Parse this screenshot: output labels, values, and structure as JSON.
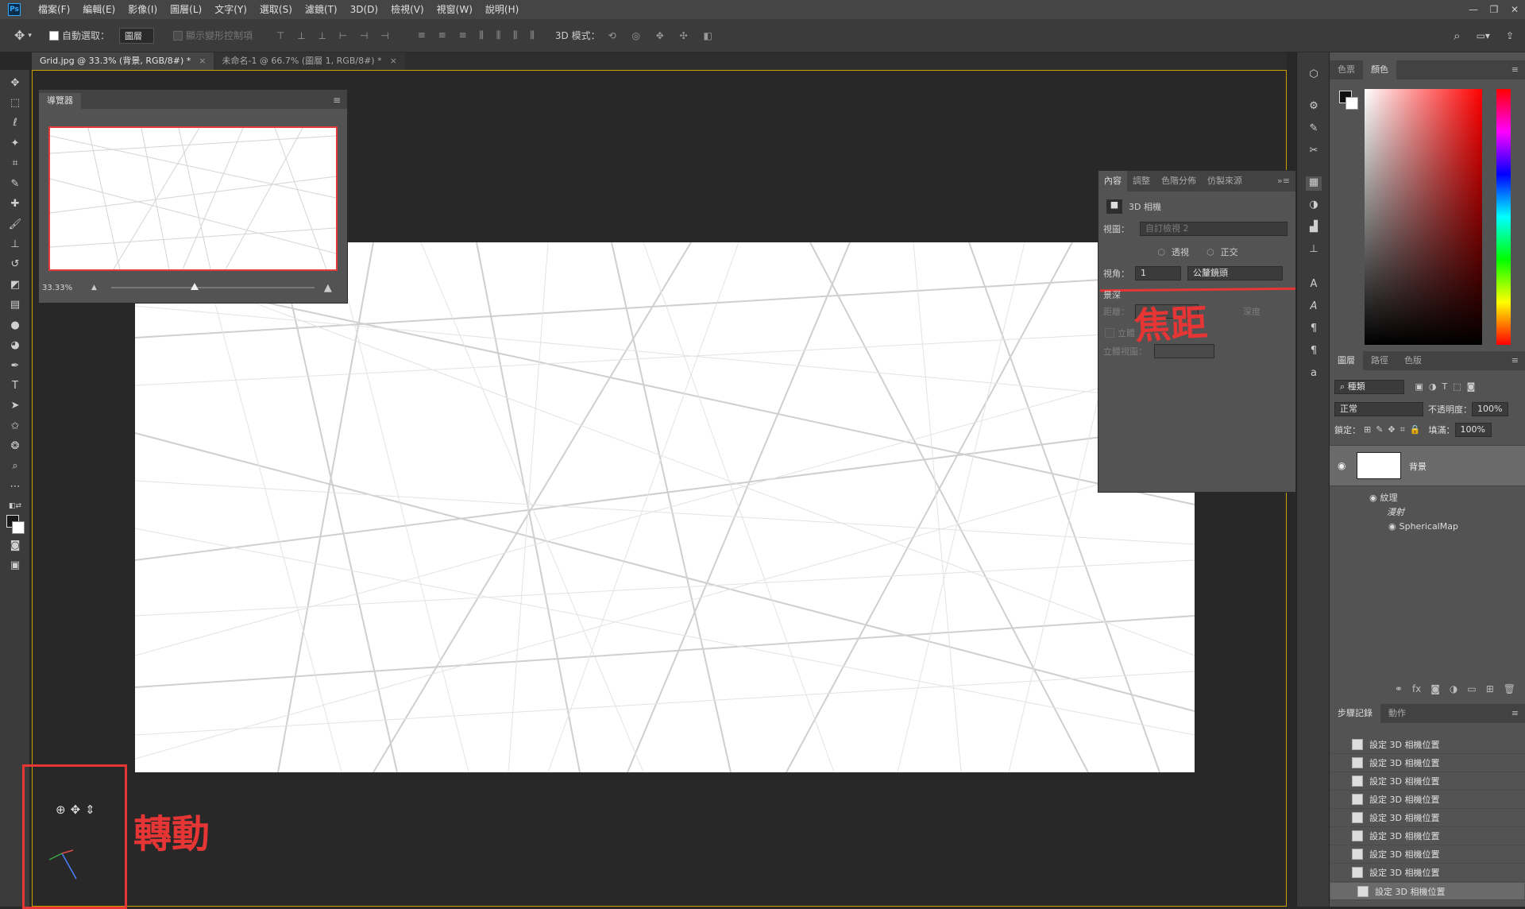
{
  "menubar": {
    "logo": "Ps",
    "items": [
      "檔案(F)",
      "編輯(E)",
      "影像(I)",
      "圖層(L)",
      "文字(Y)",
      "選取(S)",
      "濾鏡(T)",
      "3D(D)",
      "檢視(V)",
      "視窗(W)",
      "說明(H)"
    ],
    "window_controls": [
      "—",
      "❐",
      "✕"
    ]
  },
  "options": {
    "auto_select_label": "自動選取：",
    "auto_select_value": "圖層",
    "show_transform": "顯示變形控制項",
    "mode3d_label": "3D 模式："
  },
  "tabs": [
    {
      "label": "Grid.jpg @ 33.3% (背景, RGB/8#) *",
      "close": "×"
    },
    {
      "label": "未命名-1 @ 66.7% (圖層 1, RGB/8#) *",
      "close": "×"
    }
  ],
  "navigator": {
    "title": "導覽器",
    "zoom": "33.33%"
  },
  "properties": {
    "tabs": [
      "內容",
      "調整",
      "色階分佈",
      "仿製來源"
    ],
    "title": "3D 相機",
    "view_label": "視圖：",
    "view_value": "自訂檢視 2",
    "perspective": "透視",
    "orthographic": "正交",
    "fov_label": "視角：",
    "fov_value": "1",
    "fov_unit": "公釐鏡頭",
    "dof_label": "景深",
    "distance_label": "距離：",
    "distance_value": "深度",
    "stereo_label": "立體",
    "stereo_view_label": "立體視圖："
  },
  "color_panel": {
    "tabs": [
      "色票",
      "顏色"
    ]
  },
  "layers_panel": {
    "tabs": [
      "圖層",
      "路徑",
      "色版"
    ],
    "filter_value": "種類",
    "blend_mode": "正常",
    "opacity_label": "不透明度：",
    "opacity_value": "100%",
    "lock_label": "鎖定：",
    "fill_label": "填滿：",
    "fill_value": "100%",
    "layer_name": "背景",
    "texture_label": "紋理",
    "diffuse_label": "漫射",
    "map_label": "SphericalMap"
  },
  "history_panel": {
    "tabs": [
      "步驟記錄",
      "動作"
    ],
    "items": [
      "設定 3D 相機位置",
      "設定 3D 相機位置",
      "設定 3D 相機位置",
      "設定 3D 相機位置",
      "設定 3D 相機位置",
      "設定 3D 相機位置",
      "設定 3D 相機位置",
      "設定 3D 相機位置",
      "設定 3D 相機位置"
    ]
  },
  "annotations": {
    "focal": "焦距",
    "rotate": "轉動"
  },
  "colors": {
    "accent_red": "#e53535",
    "doc_border": "#c9a000"
  }
}
